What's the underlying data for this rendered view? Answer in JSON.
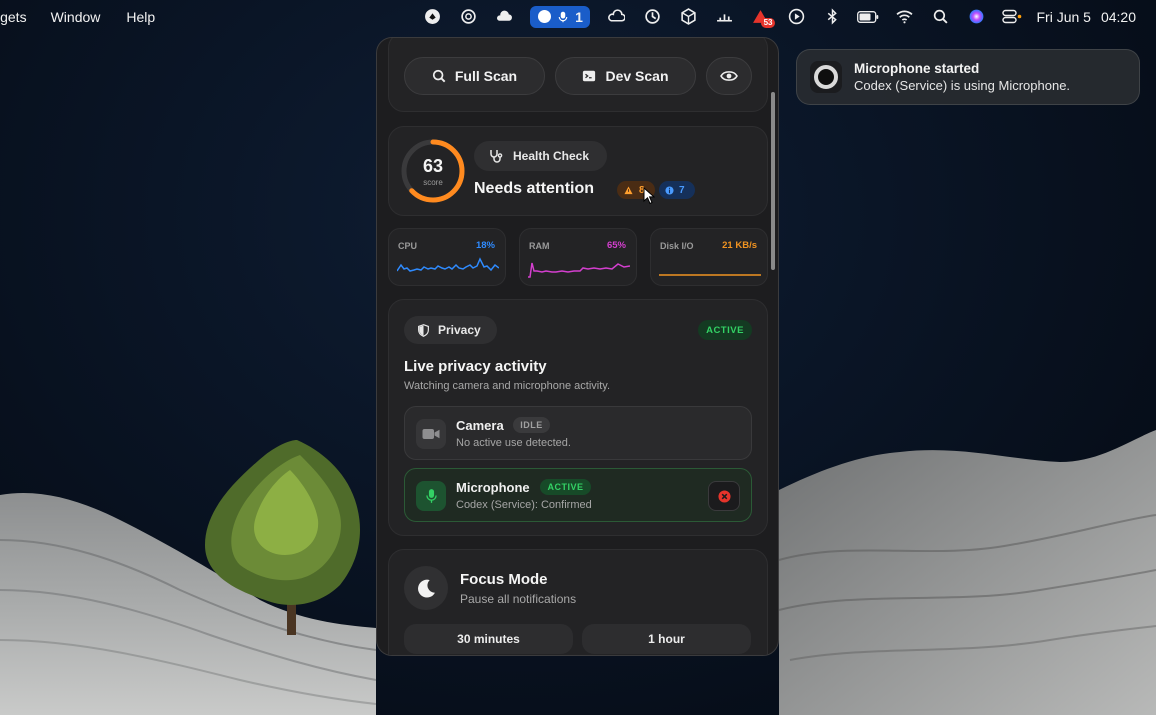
{
  "menubar": {
    "menus": [
      "lgets",
      "Window",
      "Help"
    ],
    "mic_count": "1",
    "notification_badge": "53",
    "date": "Fri Jun 5",
    "time": "04:20",
    "icons": [
      "app-icon",
      "openai-icon",
      "weather-icon",
      "camera-dot-icon",
      "microphone-icon",
      "cloud-icon",
      "vpn-icon",
      "box-icon",
      "activity-icon",
      "alert-app-icon",
      "play-icon",
      "bluetooth-icon",
      "battery-icon",
      "wifi-icon",
      "search-icon",
      "siri-icon",
      "control-center-icon"
    ]
  },
  "notification": {
    "title": "Microphone started",
    "body": "Codex (Service) is using Microphone."
  },
  "toolbar": {
    "full_scan": "Full Scan",
    "dev_scan": "Dev Scan"
  },
  "health": {
    "score": "63",
    "score_value": 63,
    "score_label": "score",
    "pill": "Health Check",
    "status": "Needs attention",
    "warnings": "8",
    "info": "7",
    "gauge_color": "#ff8a1f"
  },
  "stats": [
    {
      "name": "CPU",
      "value": "18%",
      "color": "#2f8bff"
    },
    {
      "name": "RAM",
      "value": "65%",
      "color": "#d43fcf"
    },
    {
      "name": "Disk I/O",
      "value": "21 KB/s",
      "color": "#f09321"
    }
  ],
  "privacy": {
    "pill": "Privacy",
    "status": "ACTIVE",
    "title": "Live privacy activity",
    "subtitle": "Watching camera and microphone activity.",
    "camera": {
      "name": "Camera",
      "badge": "IDLE",
      "desc": "No active use detected."
    },
    "microphone": {
      "name": "Microphone",
      "badge": "ACTIVE",
      "desc": "Codex (Service): Confirmed"
    }
  },
  "focus": {
    "title": "Focus Mode",
    "subtitle": "Pause all notifications",
    "options": [
      "30 minutes",
      "1 hour"
    ]
  }
}
